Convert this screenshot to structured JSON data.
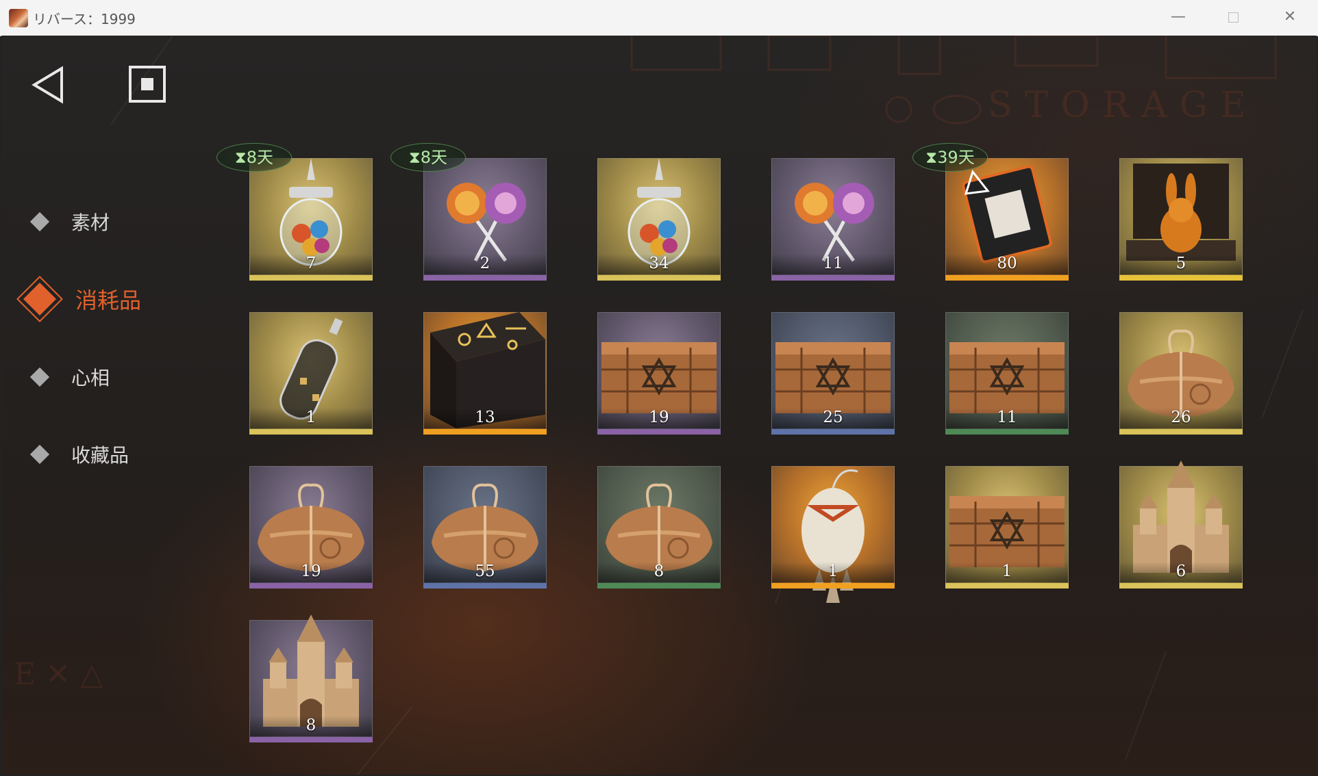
{
  "window": {
    "title": "リバース：1999"
  },
  "colors": {
    "accent": "#e1612c",
    "timer": "#b8e7a8"
  },
  "nav": {
    "back_icon": "back-triangle-icon",
    "stop_icon": "stop-square-icon"
  },
  "background": {
    "watermark": "STORAGE"
  },
  "categories": [
    {
      "label": "素材",
      "active": false
    },
    {
      "label": "消耗品",
      "active": true
    },
    {
      "label": "心相",
      "active": false
    },
    {
      "label": "收藏品",
      "active": false
    }
  ],
  "items": [
    {
      "name": "candy-jar",
      "count": "7",
      "timer": "8天",
      "bg": "gold",
      "rarity": "#d9c35a"
    },
    {
      "name": "lollipops",
      "count": "2",
      "timer": "8天",
      "bg": "purple",
      "rarity": "#8a63a6"
    },
    {
      "name": "candy-jar",
      "count": "34",
      "timer": "",
      "bg": "gold",
      "rarity": "#d9c35a"
    },
    {
      "name": "lollipops",
      "count": "11",
      "timer": "",
      "bg": "purple",
      "rarity": "#8a63a6"
    },
    {
      "name": "talisman-book",
      "count": "80",
      "timer": "39天",
      "bg": "orange",
      "rarity": "#f0a020"
    },
    {
      "name": "rabbit-chest",
      "count": "5",
      "timer": "",
      "bg": "gold",
      "rarity": "#e6c23a"
    },
    {
      "name": "bottle",
      "count": "1",
      "timer": "",
      "bg": "gold",
      "rarity": "#d9c35a"
    },
    {
      "name": "rune-table",
      "count": "13",
      "timer": "",
      "bg": "orange",
      "rarity": "#f0a020"
    },
    {
      "name": "wooden-crate",
      "count": "19",
      "timer": "",
      "bg": "purple",
      "rarity": "#8a63a6"
    },
    {
      "name": "wooden-crate",
      "count": "25",
      "timer": "",
      "bg": "blue",
      "rarity": "#5f73a8"
    },
    {
      "name": "wooden-crate",
      "count": "11",
      "timer": "",
      "bg": "green",
      "rarity": "#4f8a56"
    },
    {
      "name": "parcel",
      "count": "26",
      "timer": "",
      "bg": "gold",
      "rarity": "#d9c35a"
    },
    {
      "name": "parcel",
      "count": "19",
      "timer": "",
      "bg": "purple",
      "rarity": "#8a63a6"
    },
    {
      "name": "parcel",
      "count": "55",
      "timer": "",
      "bg": "blue",
      "rarity": "#5f73a8"
    },
    {
      "name": "parcel",
      "count": "8",
      "timer": "",
      "bg": "green",
      "rarity": "#4f8a56"
    },
    {
      "name": "ornament",
      "count": "1",
      "timer": "",
      "bg": "orange",
      "rarity": "#f0a020"
    },
    {
      "name": "wooden-crate",
      "count": "1",
      "timer": "",
      "bg": "gold",
      "rarity": "#d9c35a"
    },
    {
      "name": "sand-castle",
      "count": "6",
      "timer": "",
      "bg": "gold",
      "rarity": "#d9c35a"
    },
    {
      "name": "sand-castle",
      "count": "8",
      "timer": "",
      "bg": "purple",
      "rarity": "#8a63a6"
    }
  ]
}
